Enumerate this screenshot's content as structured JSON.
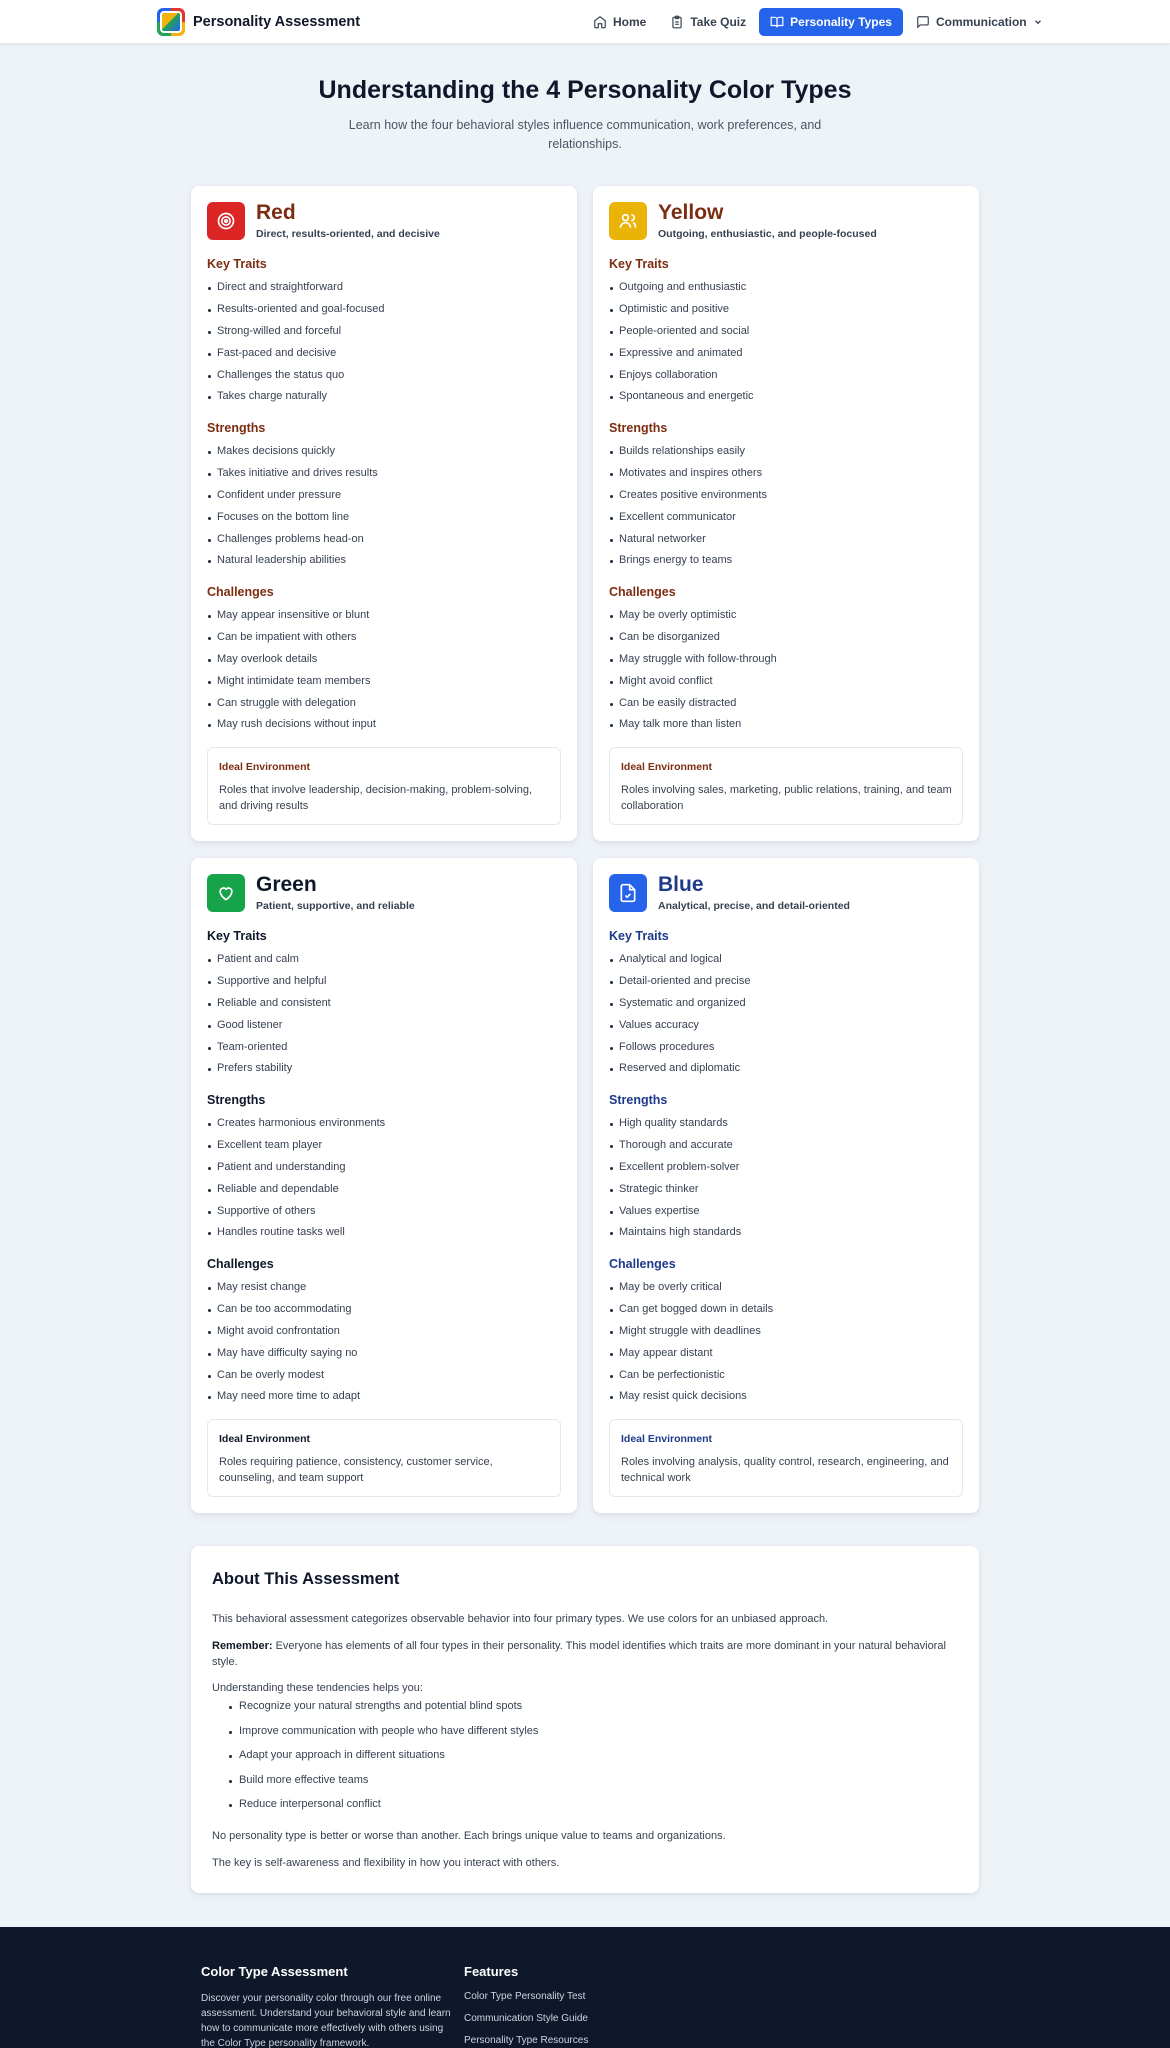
{
  "header": {
    "brand": "Personality Assessment",
    "nav": [
      {
        "label": "Home",
        "icon": "home-icon"
      },
      {
        "label": "Take Quiz",
        "icon": "clipboard-icon"
      },
      {
        "label": "Personality Types",
        "icon": "book-open-icon",
        "active": true
      },
      {
        "label": "Communication",
        "icon": "message-square-icon",
        "dropdown": true
      }
    ]
  },
  "hero": {
    "title": "Understanding the 4 Personality Color Types",
    "subtitle": "Learn how the four behavioral styles influence communication, work preferences, and relationships."
  },
  "section_labels": {
    "traits": "Key Traits",
    "strengths": "Strengths",
    "challenges": "Challenges",
    "environment": "Ideal Environment"
  },
  "types": [
    {
      "name": "Red",
      "tagline": "Direct, results-oriented, and decisive",
      "icon": "target-icon",
      "color": "#dc2626",
      "heading_color": "#7c2d12",
      "traits": [
        "Direct and straightforward",
        "Results-oriented and goal-focused",
        "Strong-willed and forceful",
        "Fast-paced and decisive",
        "Challenges the status quo",
        "Takes charge naturally"
      ],
      "strengths": [
        "Makes decisions quickly",
        "Takes initiative and drives results",
        "Confident under pressure",
        "Focuses on the bottom line",
        "Challenges problems head-on",
        "Natural leadership abilities"
      ],
      "challenges": [
        "May appear insensitive or blunt",
        "Can be impatient with others",
        "May overlook details",
        "Might intimidate team members",
        "Can struggle with delegation",
        "May rush decisions without input"
      ],
      "environment": "Roles that involve leadership, decision-making, problem-solving, and driving results"
    },
    {
      "name": "Yellow",
      "tagline": "Outgoing, enthusiastic, and people-focused",
      "icon": "users-icon",
      "color": "#eab308",
      "heading_color": "#7c2d12",
      "traits": [
        "Outgoing and enthusiastic",
        "Optimistic and positive",
        "People-oriented and social",
        "Expressive and animated",
        "Enjoys collaboration",
        "Spontaneous and energetic"
      ],
      "strengths": [
        "Builds relationships easily",
        "Motivates and inspires others",
        "Creates positive environments",
        "Excellent communicator",
        "Natural networker",
        "Brings energy to teams"
      ],
      "challenges": [
        "May be overly optimistic",
        "Can be disorganized",
        "May struggle with follow-through",
        "Might avoid conflict",
        "Can be easily distracted",
        "May talk more than listen"
      ],
      "environment": "Roles involving sales, marketing, public relations, training, and team collaboration"
    },
    {
      "name": "Green",
      "tagline": "Patient, supportive, and reliable",
      "icon": "heart-icon",
      "color": "#16a34a",
      "heading_color": "#0f172a",
      "traits": [
        "Patient and calm",
        "Supportive and helpful",
        "Reliable and consistent",
        "Good listener",
        "Team-oriented",
        "Prefers stability"
      ],
      "strengths": [
        "Creates harmonious environments",
        "Excellent team player",
        "Patient and understanding",
        "Reliable and dependable",
        "Supportive of others",
        "Handles routine tasks well"
      ],
      "challenges": [
        "May resist change",
        "Can be too accommodating",
        "Might avoid confrontation",
        "May have difficulty saying no",
        "Can be overly modest",
        "May need more time to adapt"
      ],
      "environment": "Roles requiring patience, consistency, customer service, counseling, and team support"
    },
    {
      "name": "Blue",
      "tagline": "Analytical, precise, and detail-oriented",
      "icon": "file-check-icon",
      "color": "#2563eb",
      "heading_color": "#1e3a8a",
      "traits": [
        "Analytical and logical",
        "Detail-oriented and precise",
        "Systematic and organized",
        "Values accuracy",
        "Follows procedures",
        "Reserved and diplomatic"
      ],
      "strengths": [
        "High quality standards",
        "Thorough and accurate",
        "Excellent problem-solver",
        "Strategic thinker",
        "Values expertise",
        "Maintains high standards"
      ],
      "challenges": [
        "May be overly critical",
        "Can get bogged down in details",
        "Might struggle with deadlines",
        "May appear distant",
        "Can be perfectionistic",
        "May resist quick decisions"
      ],
      "environment": "Roles involving analysis, quality control, research, engineering, and technical work"
    }
  ],
  "about": {
    "title": "About This Assessment",
    "p1": "This behavioral assessment categorizes observable behavior into four primary types. We use colors for an unbiased approach.",
    "remember_label": "Remember:",
    "remember_text": " Everyone has elements of all four types in their personality. This model identifies which traits are more dominant in your natural behavioral style.",
    "intro": "Understanding these tendencies helps you:",
    "benefits": [
      "Recognize your natural strengths and potential blind spots",
      "Improve communication with people who have different styles",
      "Adapt your approach in different situations",
      "Build more effective teams",
      "Reduce interpersonal conflict"
    ],
    "p3": "No personality type is better or worse than another. Each brings unique value to teams and organizations.",
    "p4": "The key is self-awareness and flexibility in how you interact with others."
  },
  "footer": {
    "title": "Color Type Assessment",
    "description": "Discover your personality color through our free online assessment. Understand your behavioral style and learn how to communicate more effectively with others using the Color Type personality framework.",
    "features_title": "Features",
    "features": [
      "Color Type Personality Test",
      "Communication Style Guide",
      "Personality Type Resources"
    ]
  }
}
